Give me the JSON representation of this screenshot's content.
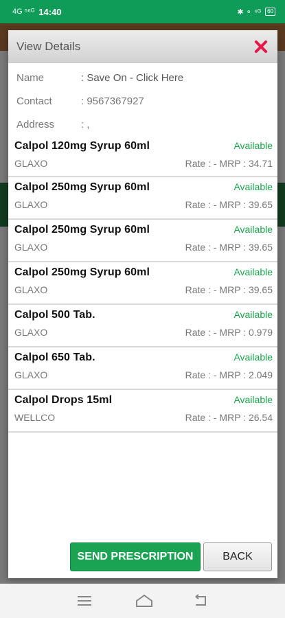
{
  "status_bar": {
    "time": "14:40",
    "left_glyphs": "4G ⁵⁶ᴳ",
    "right_glyphs": "✱ ⚬ ⁴ᴳ",
    "battery": "60"
  },
  "dialog": {
    "title": "View Details",
    "info": [
      {
        "label": "Name",
        "value": ": Save On - Click Here"
      },
      {
        "label": "Contact",
        "value": ": 9567367927"
      },
      {
        "label": "Address",
        "value": ": ,"
      }
    ],
    "items": [
      {
        "name": "Calpol 120mg Syrup 60ml",
        "status": "Available",
        "company": "GLAXO",
        "price": "Rate : -   MRP : 34.71"
      },
      {
        "name": "Calpol 250mg Syrup 60ml",
        "status": "Available",
        "company": "GLAXO",
        "price": "Rate : -   MRP : 39.65"
      },
      {
        "name": "Calpol 250mg Syrup 60ml",
        "status": "Available",
        "company": "GLAXO",
        "price": "Rate : -   MRP : 39.65"
      },
      {
        "name": "Calpol 250mg Syrup 60ml",
        "status": "Available",
        "company": "GLAXO",
        "price": "Rate : -   MRP : 39.65"
      },
      {
        "name": "Calpol 500 Tab.",
        "status": "Available",
        "company": "GLAXO",
        "price": "Rate : -   MRP : 0.979"
      },
      {
        "name": "Calpol 650 Tab.",
        "status": "Available",
        "company": "GLAXO",
        "price": "Rate : -   MRP : 2.049"
      },
      {
        "name": "Calpol Drops 15ml",
        "status": "Available",
        "company": "WELLCO",
        "price": "Rate : -   MRP : 26.54"
      }
    ],
    "send_button": "SEND PRESCRIPTION",
    "back_button": "BACK"
  },
  "colors": {
    "accent_green": "#1aa353",
    "status_green": "#1aa34a",
    "close_red": "#e8174c"
  }
}
